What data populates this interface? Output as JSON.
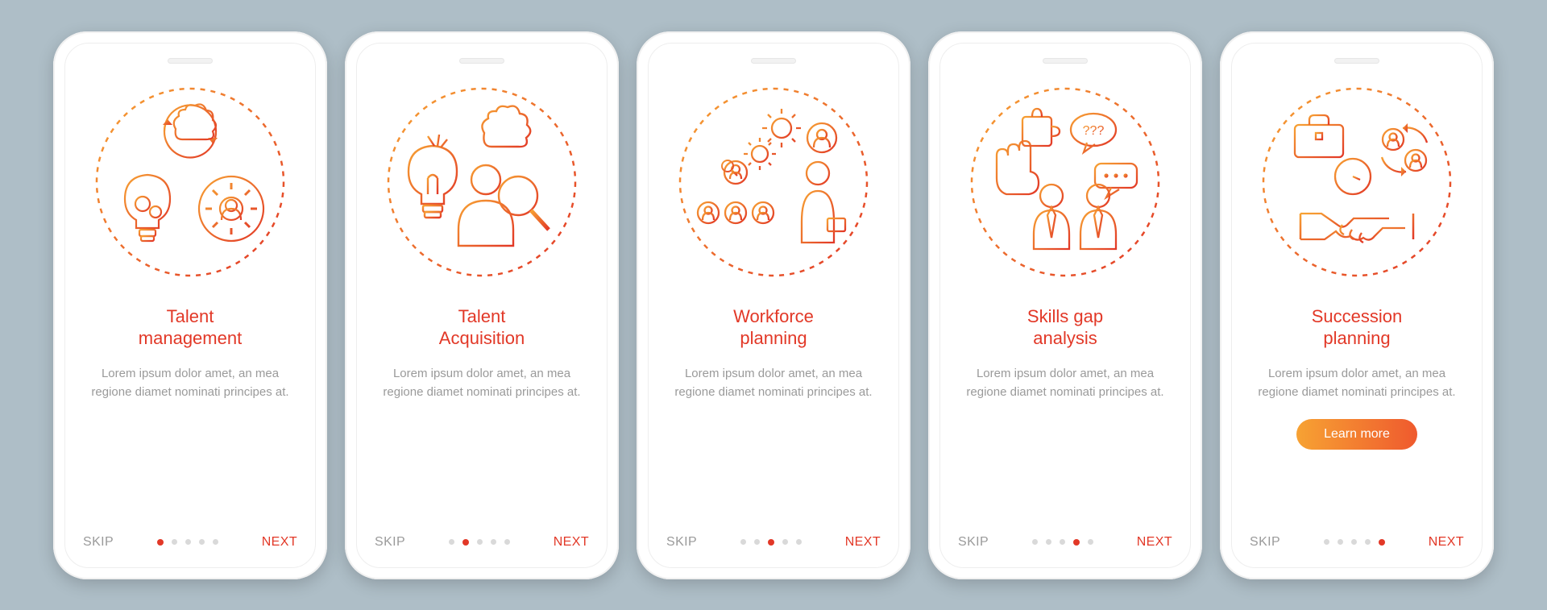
{
  "colors": {
    "accent": "#e23827",
    "grad_start": "#f7a233",
    "grad_end": "#ef5a2e",
    "muted": "#9a9a9a"
  },
  "common": {
    "skip_label": "SKIP",
    "next_label": "NEXT",
    "description": "Lorem ipsum dolor amet, an mea regione diamet nominati principes at.",
    "total_dots": 5
  },
  "screens": [
    {
      "title": "Talent\nmanagement",
      "icon": "talent-management-icon",
      "active_dot": 0,
      "has_cta": false
    },
    {
      "title": "Talent\nAcquisition",
      "icon": "talent-acquisition-icon",
      "active_dot": 1,
      "has_cta": false
    },
    {
      "title": "Workforce\nplanning",
      "icon": "workforce-planning-icon",
      "active_dot": 2,
      "has_cta": false
    },
    {
      "title": "Skills gap\nanalysis",
      "icon": "skills-gap-icon",
      "active_dot": 3,
      "has_cta": false
    },
    {
      "title": "Succession\nplanning",
      "icon": "succession-icon",
      "active_dot": 4,
      "has_cta": true,
      "cta_label": "Learn more"
    }
  ]
}
